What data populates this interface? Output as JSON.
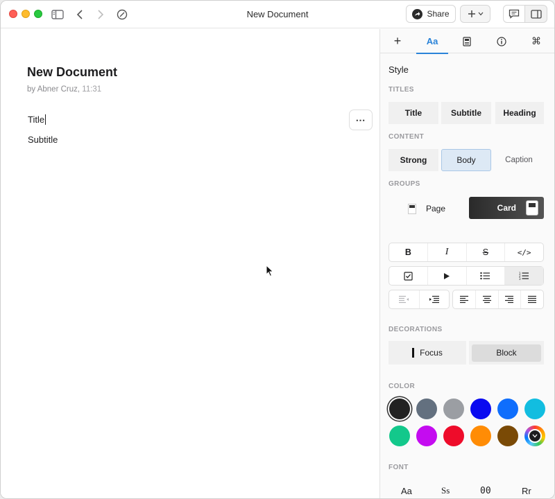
{
  "window": {
    "title": "New Document",
    "share_label": "Share",
    "traffic_lights": {
      "close": "#ff5f57",
      "minimize": "#febc2e",
      "maximize": "#28c840"
    }
  },
  "document": {
    "title": "New Document",
    "author_line": "by Abner Cruz,",
    "time": "11:31",
    "lines": [
      "Title",
      "Subtitle"
    ],
    "more_label": "⋯"
  },
  "panel": {
    "tabs": [
      {
        "name": "insert",
        "label": "+"
      },
      {
        "name": "style",
        "label": "Aa",
        "active": true
      },
      {
        "name": "document",
        "label": ""
      },
      {
        "name": "info",
        "label": ""
      },
      {
        "name": "shortcuts",
        "label": "⌘"
      }
    ],
    "heading": "Style",
    "sections": {
      "titles": "TITLES",
      "content": "CONTENT",
      "groups": "GROUPS",
      "decorations": "DECORATIONS",
      "color": "COLOR",
      "font": "FONT"
    },
    "titles": [
      "Title",
      "Subtitle",
      "Heading"
    ],
    "content": [
      "Strong",
      "Body",
      "Caption"
    ],
    "content_selected": "Body",
    "groups": {
      "page": "Page",
      "card": "Card",
      "selected": "Card"
    },
    "format_row_1": [
      "B",
      "I",
      "S",
      "</>"
    ],
    "decorations": {
      "focus": "Focus",
      "block": "Block"
    },
    "colors": [
      "#222222",
      "#63707f",
      "#9b9ea3",
      "#0a0af0",
      "#0f6efc",
      "#12bde0",
      "#13c88b",
      "#c40cf0",
      "#ee0c2a",
      "#ff8c05",
      "#7a4a06"
    ],
    "selected_color": "#222222",
    "fonts": [
      "Aa",
      "Ss",
      "00",
      "Rr"
    ]
  }
}
